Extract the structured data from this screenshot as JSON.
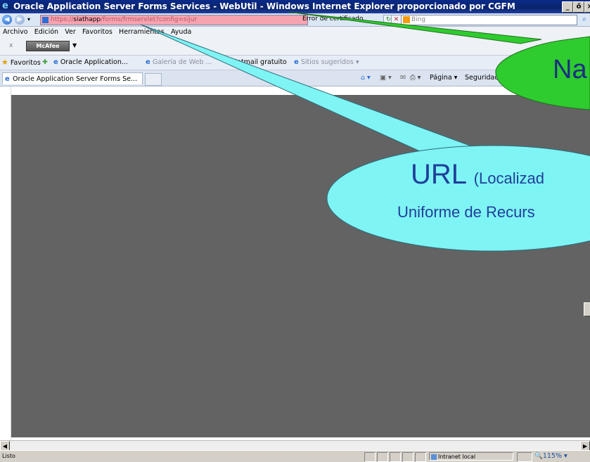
{
  "window": {
    "title": "Oracle Application Server Forms Services - WebUtil - Windows Internet Explorer proporcionado por CGFM",
    "minimize": "_",
    "restore": "ő",
    "close": "×"
  },
  "address": {
    "url_scheme": "https://",
    "url_host": "siathapp",
    "url_path": "/forms/frmservlet?config=sijur",
    "cert_label": "Error de certificado",
    "search_placeholder": "Bing"
  },
  "menu": {
    "items": [
      "Archivo",
      "Edición",
      "Ver",
      "Favoritos",
      "Herramientas",
      "Ayuda"
    ]
  },
  "mcafee": {
    "close": "x",
    "label": "McAfee"
  },
  "favorites": {
    "label": "Favoritos",
    "item1": "Oracle Application...",
    "item2": "Galería de Web ...",
    "item3": "Hotmail gratuito",
    "item4": "Sitios sugeridos"
  },
  "tabs": {
    "active": "Oracle Application Server Forms Se..."
  },
  "commandbar": {
    "page": "Página",
    "security": "Seguridad"
  },
  "status": {
    "text": "Listo",
    "zone": "Intranet local",
    "zoom": "115%"
  },
  "callouts": {
    "title_callout": "Na",
    "url_callout_main": "URL",
    "url_callout_paren": "(Localizad",
    "url_callout_line2": "Uniforme de Recurs"
  },
  "colors": {
    "callout_green": "#2ecc2e",
    "callout_cyan": "#7ff4f4",
    "content_gray": "#636363",
    "address_highlight": "#f5a3b0"
  }
}
